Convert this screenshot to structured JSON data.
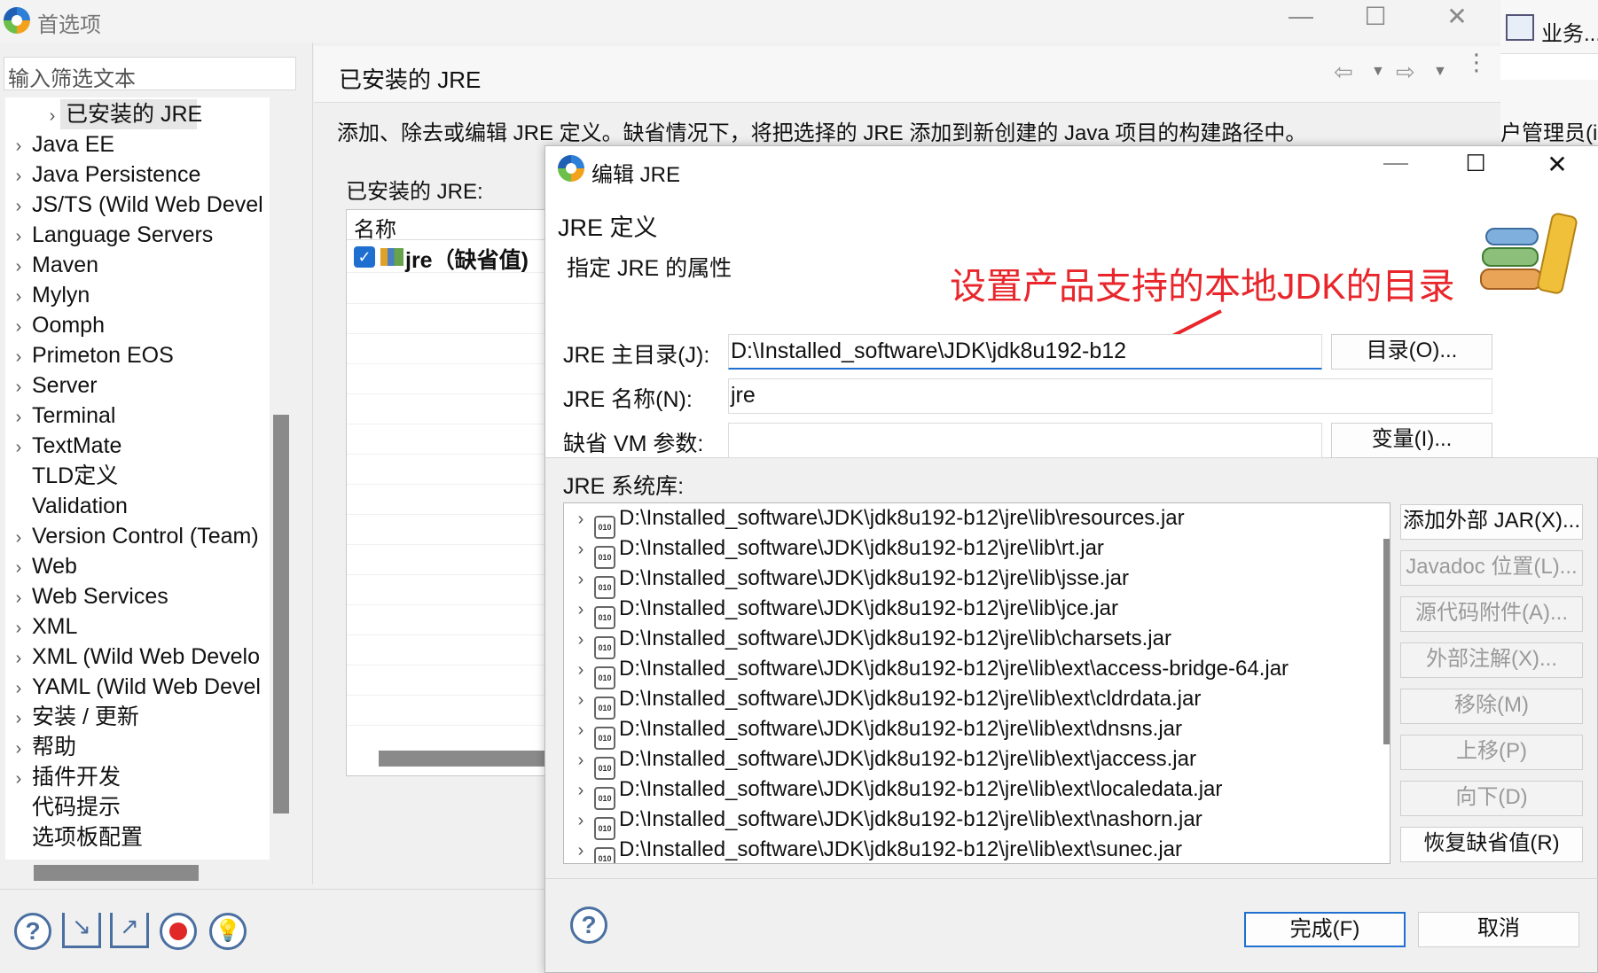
{
  "window": {
    "title": "首选项"
  },
  "sidebar": {
    "filter_placeholder": "输入筛选文本",
    "items": [
      {
        "label": "已安装的 JRE"
      },
      {
        "label": "Java EE"
      },
      {
        "label": "Java Persistence"
      },
      {
        "label": "JS/TS (Wild Web Devel"
      },
      {
        "label": "Language Servers"
      },
      {
        "label": "Maven"
      },
      {
        "label": "Mylyn"
      },
      {
        "label": "Oomph"
      },
      {
        "label": "Primeton EOS"
      },
      {
        "label": "Server"
      },
      {
        "label": "Terminal"
      },
      {
        "label": "TextMate"
      },
      {
        "label": "TLD定义"
      },
      {
        "label": "Validation"
      },
      {
        "label": "Version Control (Team)"
      },
      {
        "label": "Web"
      },
      {
        "label": "Web Services"
      },
      {
        "label": "XML"
      },
      {
        "label": "XML (Wild Web Develo"
      },
      {
        "label": "YAML (Wild Web Devel"
      },
      {
        "label": "安装 / 更新"
      },
      {
        "label": "帮助"
      },
      {
        "label": "插件开发"
      },
      {
        "label": "代码提示"
      },
      {
        "label": "选项板配置"
      }
    ]
  },
  "main": {
    "title": "已安装的 JRE",
    "description": "添加、除去或编辑 JRE 定义。缺省情况下，将把选择的 JRE 添加到新创建的 Java 项目的构建路径中。",
    "installed_label": "已安装的 JRE:",
    "table_header": "名称",
    "jre_entry": "jre（缺省值)"
  },
  "background_window": {
    "tab": "业务...",
    "text": "户管理员(ic"
  },
  "dialog": {
    "title": "编辑 JRE",
    "section_title": "JRE 定义",
    "subtitle": "指定 JRE 的属性",
    "annotation": "设置产品支持的本地JDK的目录",
    "home_label": "JRE 主目录(J):",
    "home_value": "D:\\Installed_software\\JDK\\jdk8u192-b12",
    "name_label": "JRE 名称(N):",
    "name_value": "jre",
    "vm_label": "缺省 VM 参数:",
    "vm_value": "",
    "lib_label": "JRE 系统库:",
    "libraries": [
      "D:\\Installed_software\\JDK\\jdk8u192-b12\\jre\\lib\\resources.jar",
      "D:\\Installed_software\\JDK\\jdk8u192-b12\\jre\\lib\\rt.jar",
      "D:\\Installed_software\\JDK\\jdk8u192-b12\\jre\\lib\\jsse.jar",
      "D:\\Installed_software\\JDK\\jdk8u192-b12\\jre\\lib\\jce.jar",
      "D:\\Installed_software\\JDK\\jdk8u192-b12\\jre\\lib\\charsets.jar",
      "D:\\Installed_software\\JDK\\jdk8u192-b12\\jre\\lib\\ext\\access-bridge-64.jar",
      "D:\\Installed_software\\JDK\\jdk8u192-b12\\jre\\lib\\ext\\cldrdata.jar",
      "D:\\Installed_software\\JDK\\jdk8u192-b12\\jre\\lib\\ext\\dnsns.jar",
      "D:\\Installed_software\\JDK\\jdk8u192-b12\\jre\\lib\\ext\\jaccess.jar",
      "D:\\Installed_software\\JDK\\jdk8u192-b12\\jre\\lib\\ext\\localedata.jar",
      "D:\\Installed_software\\JDK\\jdk8u192-b12\\jre\\lib\\ext\\nashorn.jar",
      "D:\\Installed_software\\JDK\\jdk8u192-b12\\jre\\lib\\ext\\sunec.jar"
    ],
    "buttons": {
      "directory": "目录(O)...",
      "variables": "变量(I)...",
      "add_external_jar": "添加外部 JAR(X)...",
      "javadoc_location": "Javadoc 位置(L)...",
      "source_attachment": "源代码附件(A)...",
      "external_annotations": "外部注解(X)...",
      "remove": "移除(M)",
      "move_up": "上移(P)",
      "move_down": "向下(D)",
      "restore_default": "恢复缺省值(R)",
      "finish": "完成(F)",
      "cancel": "取消"
    }
  },
  "colors": {
    "annotation": "#e8262b",
    "accent": "#1f6fd1"
  }
}
